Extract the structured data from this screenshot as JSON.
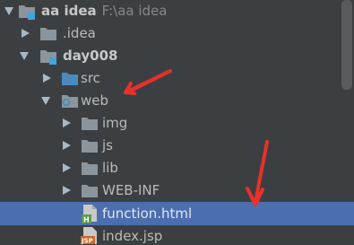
{
  "tree": {
    "root": {
      "label": "aa idea",
      "path": "F:\\aa idea",
      "icon": "module-folder-icon",
      "expanded": true
    },
    "items": [
      {
        "label": ".idea",
        "icon": "folder-icon",
        "expanded": false
      },
      {
        "label": "day008",
        "icon": "module-folder-icon",
        "expanded": true
      },
      {
        "label": "src",
        "icon": "source-folder-icon",
        "expanded": false
      },
      {
        "label": "web",
        "icon": "web-folder-icon",
        "expanded": true
      },
      {
        "label": "img",
        "icon": "folder-icon",
        "expanded": false
      },
      {
        "label": "js",
        "icon": "folder-icon",
        "expanded": false
      },
      {
        "label": "lib",
        "icon": "folder-icon",
        "expanded": false
      },
      {
        "label": "WEB-INF",
        "icon": "folder-icon",
        "expanded": false
      },
      {
        "label": "function.html",
        "icon": "html-file-icon",
        "selected": true
      },
      {
        "label": "index.jsp",
        "icon": "jsp-file-icon"
      }
    ]
  },
  "colors": {
    "background": "#3c3f41",
    "selection": "#4b6eaf",
    "text": "#bbbbbb",
    "folder": "#8b959e",
    "annotation_arrow": "#e8312a"
  }
}
